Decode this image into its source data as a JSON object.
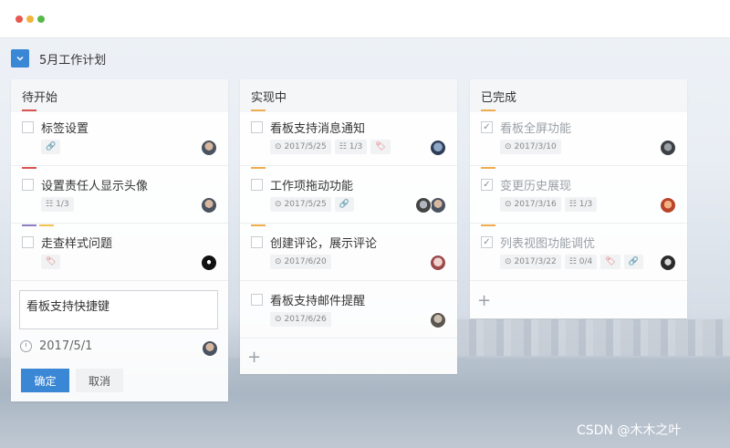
{
  "project": {
    "title": "5月工作计划",
    "collapse_icon": "chevron-down-icon"
  },
  "colors": {
    "accent": "#3a87d5",
    "red": "#d9534f",
    "orange": "#f0ad4e",
    "purple": "#8e7cc3",
    "yellow": "#f3c24f"
  },
  "columns": [
    {
      "title": "待开始",
      "cards": [
        {
          "title": "标签设置",
          "done": false,
          "bars": [
            "#d9534f"
          ],
          "meta": [
            {
              "icon": "link-icon",
              "glyph": "🔗",
              "text": ""
            }
          ]
        },
        {
          "title": "设置责任人显示头像",
          "done": false,
          "bars": [
            "#d9534f"
          ],
          "meta": [
            {
              "icon": "subtask-icon",
              "glyph": "☷",
              "text": "1/3"
            }
          ]
        },
        {
          "title": "走查样式问题",
          "done": false,
          "bars": [
            "#8e7cc3",
            "#f3c24f"
          ],
          "meta": [
            {
              "icon": "tag-icon",
              "glyph": "🏷",
              "text": ""
            }
          ]
        }
      ],
      "new_card": {
        "value": "看板支持快捷键",
        "date": "2017/5/1",
        "confirm_label": "确定",
        "cancel_label": "取消"
      }
    },
    {
      "title": "实现中",
      "cards": [
        {
          "title": "看板支持消息通知",
          "done": false,
          "bars": [
            "#f0ad4e"
          ],
          "meta": [
            {
              "icon": "clock-icon",
              "glyph": "⊙",
              "text": "2017/5/25"
            },
            {
              "icon": "subtask-icon",
              "glyph": "☷",
              "text": "1/3"
            },
            {
              "icon": "tag-icon",
              "glyph": "🏷",
              "text": ""
            }
          ]
        },
        {
          "title": "工作项拖动功能",
          "done": false,
          "bars": [
            "#f0ad4e"
          ],
          "meta": [
            {
              "icon": "clock-icon",
              "glyph": "⊙",
              "text": "2017/5/25"
            },
            {
              "icon": "link-icon",
              "glyph": "🔗",
              "text": ""
            }
          ]
        },
        {
          "title": "创建评论，展示评论",
          "done": false,
          "bars": [
            "#f0ad4e"
          ],
          "meta": [
            {
              "icon": "clock-icon",
              "glyph": "⊙",
              "text": "2017/6/20"
            }
          ]
        },
        {
          "title": "看板支持邮件提醒",
          "done": false,
          "bars": [],
          "meta": [
            {
              "icon": "clock-icon",
              "glyph": "⊙",
              "text": "2017/6/26"
            }
          ]
        }
      ],
      "add_label": "+"
    },
    {
      "title": "已完成",
      "cards": [
        {
          "title": "看板全屏功能",
          "done": true,
          "bars": [
            "#f0ad4e"
          ],
          "meta": [
            {
              "icon": "clock-icon",
              "glyph": "⊙",
              "text": "2017/3/10"
            }
          ]
        },
        {
          "title": "变更历史展现",
          "done": true,
          "bars": [
            "#f0ad4e"
          ],
          "meta": [
            {
              "icon": "clock-icon",
              "glyph": "⊙",
              "text": "2017/3/16"
            },
            {
              "icon": "subtask-icon",
              "glyph": "☷",
              "text": "1/3"
            }
          ]
        },
        {
          "title": "列表视图功能调优",
          "done": true,
          "bars": [
            "#f0ad4e"
          ],
          "meta": [
            {
              "icon": "clock-icon",
              "glyph": "⊙",
              "text": "2017/3/22"
            },
            {
              "icon": "subtask-icon",
              "glyph": "☷",
              "text": "0/4"
            },
            {
              "icon": "tag-icon",
              "glyph": "🏷",
              "text": ""
            },
            {
              "icon": "link-icon",
              "glyph": "🔗",
              "text": ""
            }
          ]
        }
      ],
      "add_label": "+"
    }
  ],
  "watermark": "CSDN @木木之叶"
}
